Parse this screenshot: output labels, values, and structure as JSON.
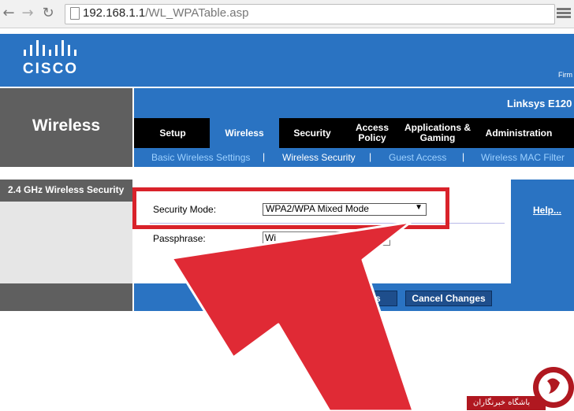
{
  "browser": {
    "url_host": "192.168.1.1",
    "url_path": "/WL_WPATable.asp"
  },
  "header": {
    "brand": "CISCO",
    "firmware_label": "Firm"
  },
  "sidebar": {
    "section_title": "Wireless",
    "sub_title": "2.4 GHz Wireless Security"
  },
  "product": {
    "name": "Linksys E120"
  },
  "tabs": [
    {
      "label": "Setup"
    },
    {
      "label": "Wireless",
      "active": true
    },
    {
      "label": "Security"
    },
    {
      "label": "Access Policy"
    },
    {
      "label": "Applications & Gaming"
    },
    {
      "label": "Administration"
    }
  ],
  "subtabs": [
    {
      "label": "Basic Wireless Settings"
    },
    {
      "label": "Wireless Security",
      "active": true
    },
    {
      "label": "Guest Access"
    },
    {
      "label": "Wireless MAC Filter"
    }
  ],
  "form": {
    "security_mode_label": "Security Mode:",
    "security_mode_value": "WPA2/WPA Mixed Mode",
    "passphrase_label": "Passphrase:",
    "passphrase_value": "Wi"
  },
  "help_link": "Help...",
  "buttons": {
    "save_partial": "ngs",
    "cancel": "Cancel Changes"
  },
  "watermark": {
    "text": "باشگاه خبرنگاران"
  },
  "colors": {
    "cisco_blue": "#2a73c2",
    "highlight_red": "#d9222a",
    "arrow_red": "#e02a35"
  }
}
